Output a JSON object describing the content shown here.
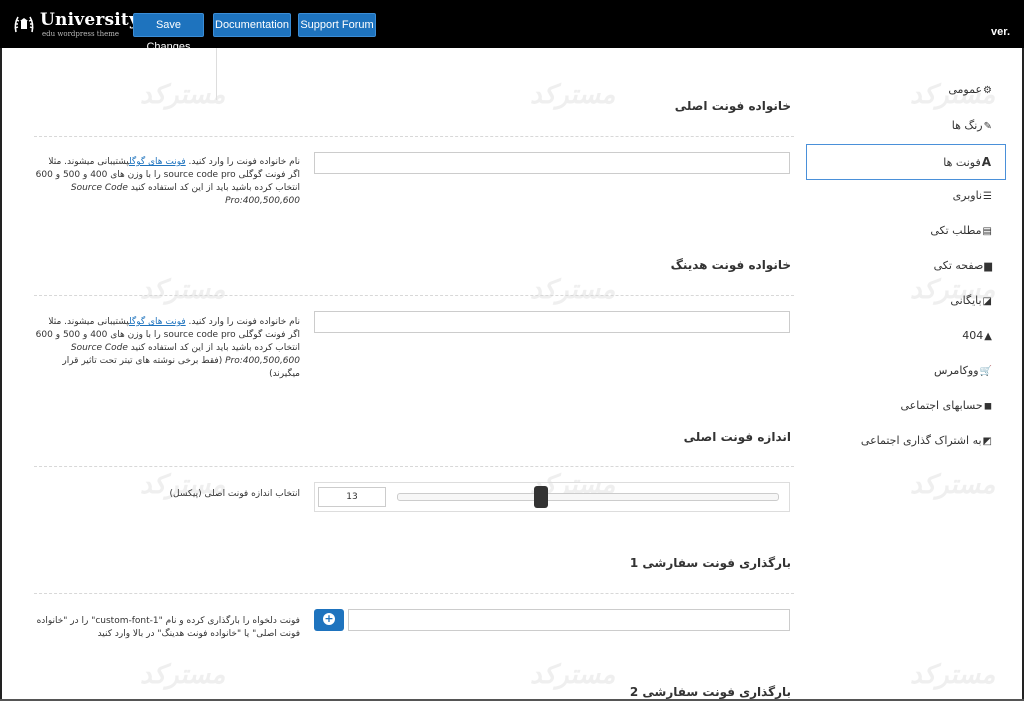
{
  "header": {
    "logo_title": "University",
    "logo_subtitle": "edu wordpress theme",
    "save_label": "Save Changes",
    "doc_label": "Documentation",
    "forum_label": "Support Forum",
    "version_label": "ver."
  },
  "watermark": "مسترکد",
  "sidebar": {
    "items": [
      {
        "label": "عمومی",
        "icon": "cogs-icon"
      },
      {
        "label": "رنگ ها",
        "icon": "brush-icon"
      },
      {
        "label": "فونت ها",
        "icon": "font-icon"
      },
      {
        "label": "ناوبری",
        "icon": "menu-icon"
      },
      {
        "label": "مطلب تکی",
        "icon": "document-icon"
      },
      {
        "label": "صفحه تکی",
        "icon": "page-icon"
      },
      {
        "label": "بایگانی",
        "icon": "archive-icon"
      },
      {
        "label": "404",
        "icon": "warning-icon"
      },
      {
        "label": "ووکامرس",
        "icon": "cart-icon"
      },
      {
        "label": "حسابهای اجتماعی",
        "icon": "social-icon"
      },
      {
        "label": "به اشتراک گذاری اجتماعی",
        "icon": "share-icon"
      }
    ],
    "active_index": 2
  },
  "sections": {
    "main_font": {
      "title": "خانواده فونت اصلی",
      "desc_before_link": "نام خانواده فونت را وارد کنید. ",
      "link": "فونت های گوگل",
      "desc_after_link": "پشتیبانی میشوند. مثلا اگر فونت گوگلی source code pro را با وزن های 400 و 500 و 600 انتخاب کرده باشید باید از این کد استفاده کنید ",
      "code": "Source Code Pro:400,500,600",
      "value": ""
    },
    "heading_font": {
      "title": "خانواده فونت هدینگ",
      "desc_before_link": "نام خانواده فونت را وارد کنید. ",
      "link": "فونت های گوگل",
      "desc_after_link": "پشتیبانی میشوند. مثلا اگر فونت گوگلی source code pro را با وزن های 400 و 500 و 600 انتخاب کرده باشید باید از این کد استفاده کنید ",
      "code": "Source Code Pro:400,500,600",
      "note": " (فقط برخی نوشته های تیتر تحت تاثیر قرار میگیرند)",
      "value": ""
    },
    "font_size": {
      "title": "اندازه فونت اصلی",
      "desc": "انتخاب اندازه فونت اصلی (پیکسل)",
      "value": "13"
    },
    "custom_font_1": {
      "title": "بارگذاری فونت سفارشی 1",
      "desc": "فونت دلخواه را بارگذاری کرده و نام \"custom-font-1\" را در \"خانواده فونت اصلی\" یا \"خانواده فونت هدینگ\" در بالا وارد کنید",
      "value": ""
    },
    "custom_font_2": {
      "title": "بارگذاری فونت سفارشی 2"
    }
  }
}
